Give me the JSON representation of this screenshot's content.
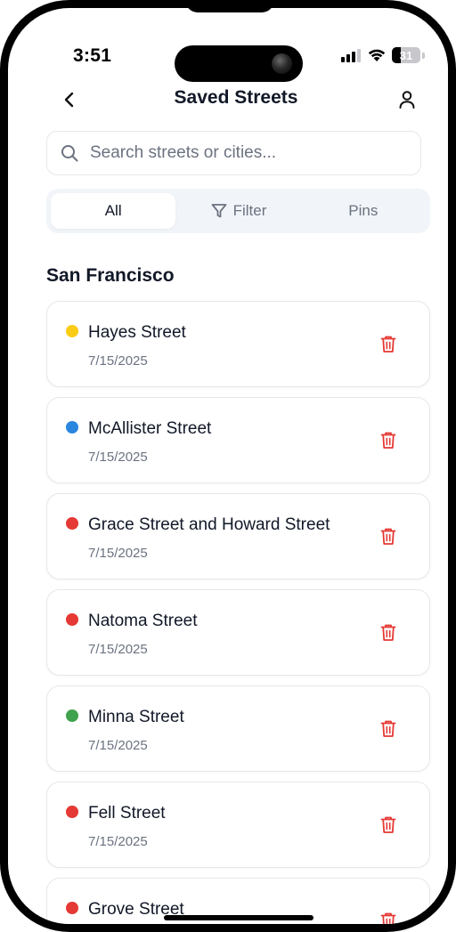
{
  "status_bar": {
    "time": "3:51",
    "battery": "31",
    "battery_level": 0.31
  },
  "header": {
    "title": "Saved Streets",
    "back_icon": "chevron-left-icon",
    "profile_icon": "user-icon"
  },
  "search": {
    "placeholder": "Search streets or cities...",
    "value": ""
  },
  "tabs": [
    {
      "label": "All",
      "active": true,
      "icon": ""
    },
    {
      "label": "Filter",
      "active": false,
      "icon": "filter-icon"
    },
    {
      "label": "Pins",
      "active": false,
      "icon": ""
    }
  ],
  "section": {
    "title": "San Francisco"
  },
  "colors": {
    "yellow": "#FACC15",
    "blue": "#2B86E0",
    "red": "#E53935",
    "green": "#3FA34D",
    "delete": "#E53935"
  },
  "streets": [
    {
      "name": "Hayes Street",
      "date": "7/15/2025",
      "color": "#FACC15"
    },
    {
      "name": "McAllister Street",
      "date": "7/15/2025",
      "color": "#2B86E0"
    },
    {
      "name": "Grace Street and Howard Street",
      "date": "7/15/2025",
      "color": "#E53935"
    },
    {
      "name": "Natoma Street",
      "date": "7/15/2025",
      "color": "#E53935"
    },
    {
      "name": "Minna Street",
      "date": "7/15/2025",
      "color": "#3FA34D"
    },
    {
      "name": "Fell Street",
      "date": "7/15/2025",
      "color": "#E53935"
    },
    {
      "name": "Grove Street",
      "date": "",
      "color": "#E53935"
    }
  ]
}
